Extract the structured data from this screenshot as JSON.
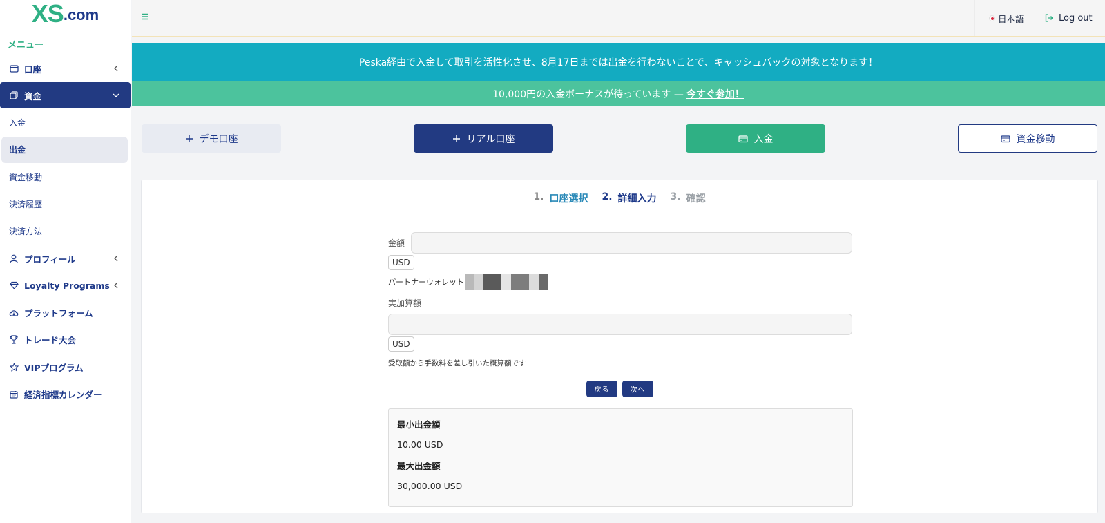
{
  "sidebar": {
    "logo_main": "XS",
    "logo_suffix": ".com",
    "menu_title": "メニュー",
    "items": [
      {
        "label": "口座",
        "icon": "wallet-icon"
      },
      {
        "label": "資金",
        "icon": "money-icon"
      },
      {
        "label": "プロフィール",
        "icon": "user-icon"
      },
      {
        "label": "Loyalty Programs",
        "icon": "diamond-icon"
      },
      {
        "label": "プラットフォーム",
        "icon": "cloud-download-icon"
      },
      {
        "label": "トレード大会",
        "icon": "trophy-icon"
      },
      {
        "label": "VIPプログラム",
        "icon": "star-icon"
      },
      {
        "label": "経済指標カレンダー",
        "icon": "calendar-icon"
      }
    ],
    "sub_items": [
      "入金",
      "出金",
      "資金移動",
      "決済履歴",
      "決済方法"
    ]
  },
  "header": {
    "language": "日本語",
    "logout": "Log out"
  },
  "banners": {
    "promo": "Peska経由で入金して取引を活性化させ、8月17日までは出金を行わないことで、キャッシュバックの対象となります！",
    "bonus_text": "10,000円の入金ボーナスが待っています —",
    "bonus_link": "今すぐ参加！"
  },
  "actions": {
    "demo": "デモ口座",
    "real": "リアル口座",
    "deposit": "入金",
    "transfer": "資金移動"
  },
  "steps": [
    {
      "num": "1.",
      "label": "口座選択"
    },
    {
      "num": "2.",
      "label": "詳細入力"
    },
    {
      "num": "3.",
      "label": "確認"
    }
  ],
  "form": {
    "amount_label": "金額",
    "amount_value": "",
    "currency": "USD",
    "wallet_label": "パートナーウォレット",
    "actual_label": "実加算額",
    "actual_value": "",
    "actual_currency": "USD",
    "note": "受取額から手数料を差し引いた概算額です",
    "back": "戻る",
    "next": "次へ"
  },
  "limits": {
    "min_label": "最小出金額",
    "min_value": "10.00 USD",
    "max_label": "最大出金額",
    "max_value": "30,000.00 USD"
  },
  "colors": {
    "brand_green": "#2fb084",
    "brand_navy": "#223a82",
    "banner_teal": "#13abc1",
    "banner_green": "#4cc39d"
  }
}
